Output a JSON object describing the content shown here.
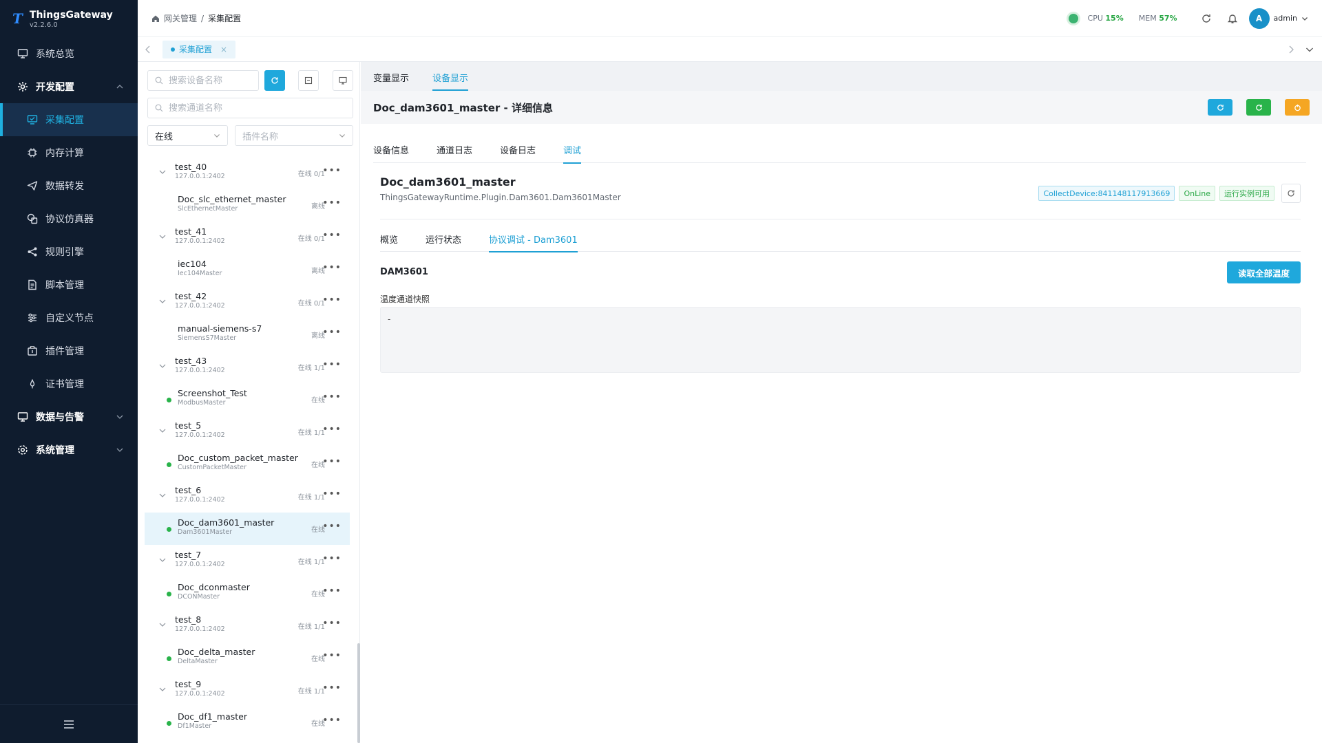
{
  "app": {
    "name": "ThingsGateway",
    "version": "v2.2.6.0"
  },
  "sidebar": {
    "items": [
      {
        "label": "系统总览",
        "icon": "monitor-icon"
      },
      {
        "label": "开发配置",
        "icon": "gear-icon"
      },
      {
        "label": "采集配置",
        "icon": "collect-icon"
      },
      {
        "label": "内存计算",
        "icon": "chip-icon"
      },
      {
        "label": "数据转发",
        "icon": "send-icon"
      },
      {
        "label": "协议仿真器",
        "icon": "simulator-icon"
      },
      {
        "label": "规则引擎",
        "icon": "share-icon"
      },
      {
        "label": "脚本管理",
        "icon": "document-icon"
      },
      {
        "label": "自定义节点",
        "icon": "sliders-icon"
      },
      {
        "label": "插件管理",
        "icon": "plugin-icon"
      },
      {
        "label": "证书管理",
        "icon": "certificate-icon"
      },
      {
        "label": "数据与告警",
        "icon": "alarm-icon"
      },
      {
        "label": "系统管理",
        "icon": "settings-icon"
      }
    ]
  },
  "breadcrumb": {
    "root": "网关管理",
    "sep": "/",
    "current": "采集配置"
  },
  "status": {
    "cpu_label": "CPU",
    "cpu_value": "15%",
    "mem_label": "MEM",
    "mem_value": "57%"
  },
  "user": {
    "initial": "A",
    "name": "admin"
  },
  "page_tab": {
    "label": "采集配置",
    "close": "×"
  },
  "tree_panel": {
    "search_device_placeholder": "搜索设备名称",
    "search_channel_placeholder": "搜索通道名称",
    "status_filter": "在线",
    "plugin_filter": "插件名称"
  },
  "tree": [
    {
      "name": "test_40",
      "sub": "127.0.0.1:2402",
      "status": "在线 0/1",
      "kind": "channel"
    },
    {
      "name": "Doc_slc_ethernet_master",
      "sub": "SlcEthernetMaster",
      "status": "离线",
      "kind": "device",
      "online": false
    },
    {
      "name": "test_41",
      "sub": "127.0.0.1:2402",
      "status": "在线 0/1",
      "kind": "channel"
    },
    {
      "name": "iec104",
      "sub": "Iec104Master",
      "status": "离线",
      "kind": "device",
      "online": false
    },
    {
      "name": "test_42",
      "sub": "127.0.0.1:2402",
      "status": "在线 0/1",
      "kind": "channel"
    },
    {
      "name": "manual-siemens-s7",
      "sub": "SiemensS7Master",
      "status": "离线",
      "kind": "device",
      "online": false
    },
    {
      "name": "test_43",
      "sub": "127.0.0.1:2402",
      "status": "在线 1/1",
      "kind": "channel"
    },
    {
      "name": "Screenshot_Test",
      "sub": "ModbusMaster",
      "status": "在线",
      "kind": "device",
      "online": true
    },
    {
      "name": "test_5",
      "sub": "127.0.0.1:2402",
      "status": "在线 1/1",
      "kind": "channel"
    },
    {
      "name": "Doc_custom_packet_master",
      "sub": "CustomPacketMaster",
      "status": "在线",
      "kind": "device",
      "online": true
    },
    {
      "name": "test_6",
      "sub": "127.0.0.1:2402",
      "status": "在线 1/1",
      "kind": "channel"
    },
    {
      "name": "Doc_dam3601_master",
      "sub": "Dam3601Master",
      "status": "在线",
      "kind": "device",
      "online": true,
      "selected": true
    },
    {
      "name": "test_7",
      "sub": "127.0.0.1:2402",
      "status": "在线 1/1",
      "kind": "channel"
    },
    {
      "name": "Doc_dconmaster",
      "sub": "DCONMaster",
      "status": "在线",
      "kind": "device",
      "online": true
    },
    {
      "name": "test_8",
      "sub": "127.0.0.1:2402",
      "status": "在线 1/1",
      "kind": "channel"
    },
    {
      "name": "Doc_delta_master",
      "sub": "DeltaMaster",
      "status": "在线",
      "kind": "device",
      "online": true
    },
    {
      "name": "test_9",
      "sub": "127.0.0.1:2402",
      "status": "在线 1/1",
      "kind": "channel"
    },
    {
      "name": "Doc_df1_master",
      "sub": "Df1Master",
      "status": "在线",
      "kind": "device",
      "online": true
    }
  ],
  "main": {
    "view_tabs": [
      "变量显示",
      "设备显示"
    ],
    "detail_title": "Doc_dam3601_master - 详细信息",
    "sub_tabs": [
      "设备信息",
      "通道日志",
      "设备日志",
      "调试"
    ],
    "device": {
      "name": "Doc_dam3601_master",
      "plugin": "ThingsGatewayRuntime.Plugin.Dam3601.Dam3601Master",
      "tag_id": "CollectDevice:841148117913669",
      "tag_state": "OnLine",
      "tag_runtime": "运行实例可用"
    },
    "inner_tabs": [
      "概览",
      "运行状态",
      "协议调试 - Dam3601"
    ],
    "section_title": "DAM3601",
    "read_button": "读取全部温度",
    "snapshot_label": "温度通道快照",
    "snapshot_value": "-"
  },
  "colors": {
    "accent": "#1fa8dc",
    "sidebar_bg": "#0f1c2e",
    "online": "#29b34a",
    "warning": "#f5a623"
  }
}
